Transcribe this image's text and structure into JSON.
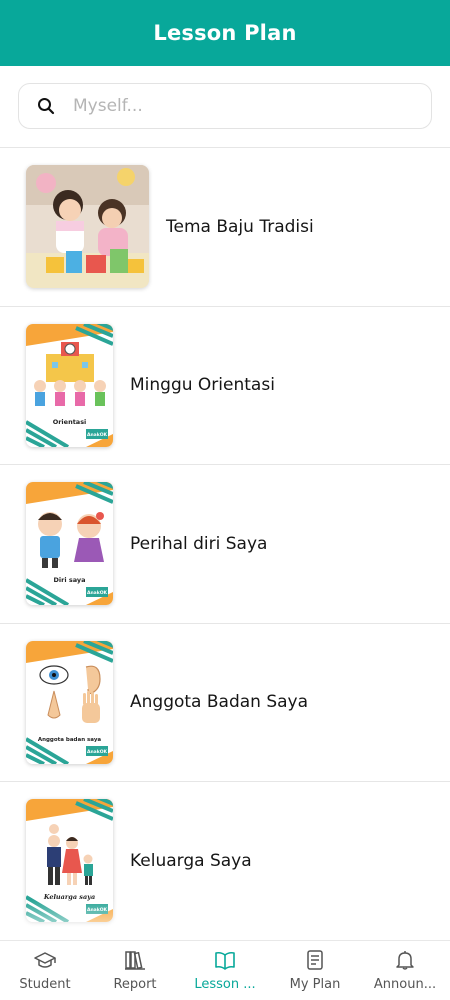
{
  "header": {
    "title": "Lesson Plan"
  },
  "search": {
    "placeholder": "Myself...",
    "value": ""
  },
  "lessons": [
    {
      "label": "Tema Baju Tradisi",
      "thumbnail": "photo-children-playing-blocks"
    },
    {
      "label": "Minggu Orientasi",
      "thumbnail": "card-orientasi",
      "card_caption": "Orientasi"
    },
    {
      "label": "Perihal diri Saya",
      "thumbnail": "card-diri-saya",
      "card_caption": "Diri saya"
    },
    {
      "label": "Anggota Badan Saya",
      "thumbnail": "card-anggota-badan",
      "card_caption": "Anggota badan saya"
    },
    {
      "label": "Keluarga Saya",
      "thumbnail": "card-keluarga",
      "card_caption": "Keluarga saya"
    }
  ],
  "card_brand": "AnakOK",
  "bottom_nav": [
    {
      "label": "Student",
      "icon": "graduation-cap-icon",
      "active": false
    },
    {
      "label": "Report",
      "icon": "books-icon",
      "active": false
    },
    {
      "label": "Lesson ...",
      "icon": "open-book-icon",
      "active": true
    },
    {
      "label": "My Plan",
      "icon": "clipboard-icon",
      "active": false
    },
    {
      "label": "Announ...",
      "icon": "bell-icon",
      "active": false
    }
  ],
  "colors": {
    "accent": "#08a89a",
    "card_orange": "#f7a53a",
    "card_teal": "#2ba597"
  }
}
